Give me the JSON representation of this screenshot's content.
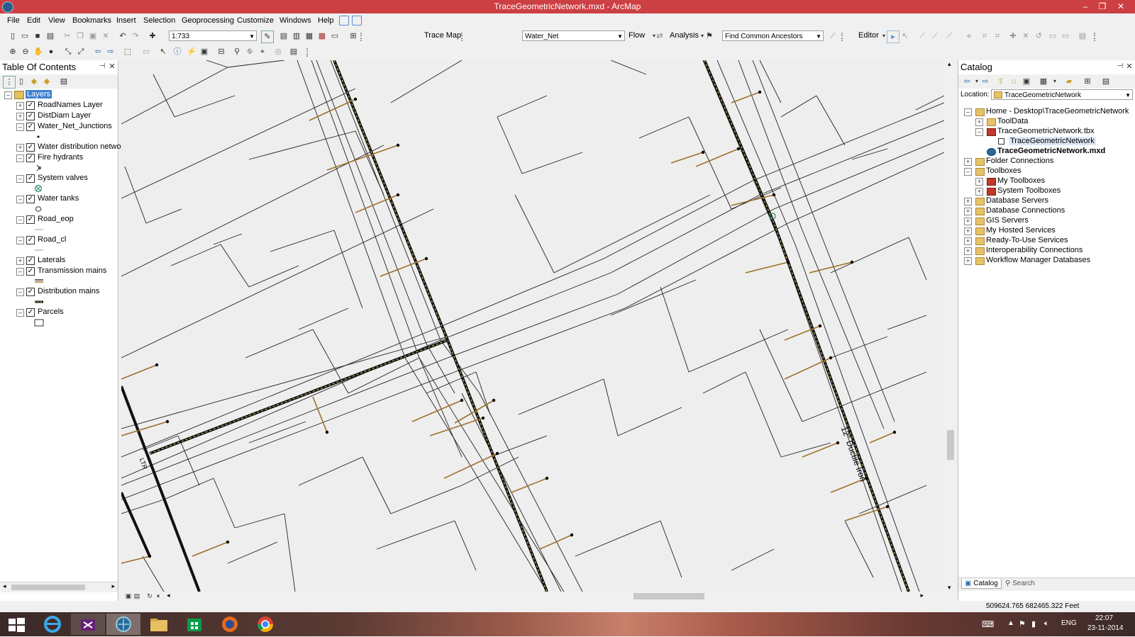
{
  "window": {
    "title": "TraceGeometricNetwork.mxd - ArcMap",
    "buttons": [
      "–",
      "❐",
      "✕"
    ]
  },
  "menu": [
    "File",
    "Edit",
    "View",
    "Bookmarks",
    "Insert",
    "Selection",
    "Geoprocessing",
    "Customize",
    "Windows",
    "Help"
  ],
  "toolbar": {
    "scale": "1:733",
    "trace_map_label": "Trace Map",
    "network": "Water_Net",
    "flow_label": "Flow",
    "analysis_label": "Analysis",
    "trace_task": "Find Common Ancestors",
    "editor_label": "Editor"
  },
  "toc": {
    "title": "Table Of Contents",
    "root": "Layers",
    "layers": [
      {
        "name": "RoadNames Layer",
        "expander": "+",
        "symbol": "none"
      },
      {
        "name": "DistDiam Layer",
        "expander": "+",
        "symbol": "none"
      },
      {
        "name": "Water_Net_Junctions",
        "expander": "–",
        "symbol": "dot"
      },
      {
        "name": "Water distribution netwo",
        "expander": "+",
        "symbol": "none"
      },
      {
        "name": "Fire hydrants",
        "expander": "–",
        "symbol": "hydrant"
      },
      {
        "name": "System valves",
        "expander": "–",
        "symbol": "valve"
      },
      {
        "name": "Water tanks",
        "expander": "–",
        "symbol": "tank"
      },
      {
        "name": "Road_eop",
        "expander": "–",
        "symbol": "line-grey"
      },
      {
        "name": "Road_cl",
        "expander": "–",
        "symbol": "line-grey"
      },
      {
        "name": "Laterals",
        "expander": "+",
        "symbol": "none"
      },
      {
        "name": "Transmission mains",
        "expander": "–",
        "symbol": "double-line"
      },
      {
        "name": "Distribution mains",
        "expander": "–",
        "symbol": "dash-line"
      },
      {
        "name": "Parcels",
        "expander": "–",
        "symbol": "rect"
      }
    ]
  },
  "catalog": {
    "title": "Catalog",
    "location_label": "Location:",
    "location_value": "TraceGeometricNetwork",
    "tree": [
      {
        "label": "Home - Desktop\\TraceGeometricNetwork",
        "level": 0,
        "expander": "–",
        "icon": "home-folder",
        "bold": false,
        "selected": false
      },
      {
        "label": "ToolData",
        "level": 1,
        "expander": "+",
        "icon": "folder",
        "bold": false,
        "selected": false
      },
      {
        "label": "TraceGeometricNetwork.tbx",
        "level": 1,
        "expander": "–",
        "icon": "toolbox",
        "bold": false,
        "selected": false
      },
      {
        "label": "TraceGeometricNetwork",
        "level": 2,
        "expander": "",
        "icon": "model",
        "bold": false,
        "selected": true
      },
      {
        "label": "TraceGeometricNetwork.mxd",
        "level": 1,
        "expander": "",
        "icon": "mxd",
        "bold": true,
        "selected": false
      },
      {
        "label": "Folder Connections",
        "level": 0,
        "expander": "+",
        "icon": "folder",
        "bold": false,
        "selected": false
      },
      {
        "label": "Toolboxes",
        "level": 0,
        "expander": "–",
        "icon": "folder",
        "bold": false,
        "selected": false
      },
      {
        "label": "My Toolboxes",
        "level": 1,
        "expander": "+",
        "icon": "toolbox",
        "bold": false,
        "selected": false
      },
      {
        "label": "System Toolboxes",
        "level": 1,
        "expander": "+",
        "icon": "toolbox",
        "bold": false,
        "selected": false
      },
      {
        "label": "Database Servers",
        "level": 0,
        "expander": "+",
        "icon": "folder",
        "bold": false,
        "selected": false
      },
      {
        "label": "Database Connections",
        "level": 0,
        "expander": "+",
        "icon": "folder",
        "bold": false,
        "selected": false
      },
      {
        "label": "GIS Servers",
        "level": 0,
        "expander": "+",
        "icon": "folder",
        "bold": false,
        "selected": false
      },
      {
        "label": "My Hosted Services",
        "level": 0,
        "expander": "+",
        "icon": "folder",
        "bold": false,
        "selected": false
      },
      {
        "label": "Ready-To-Use Services",
        "level": 0,
        "expander": "+",
        "icon": "folder",
        "bold": false,
        "selected": false
      },
      {
        "label": "Interoperability Connections",
        "level": 0,
        "expander": "+",
        "icon": "folder",
        "bold": false,
        "selected": false
      },
      {
        "label": "Workflow Manager Databases",
        "level": 0,
        "expander": "+",
        "icon": "folder",
        "bold": false,
        "selected": false
      }
    ],
    "tabs": [
      "Catalog",
      "Search"
    ]
  },
  "map": {
    "road_label": "12\" Ductile Iron",
    "small_label": "LTR"
  },
  "status": {
    "coords": "509624.765  682465.322 Feet"
  },
  "taskbar": {
    "lang": "ENG",
    "time": "22:07",
    "date": "23-11-2014"
  },
  "colors": {
    "titlebar": "#cc3f43",
    "lateral": "#a0702a",
    "main": "#111111",
    "parcel": "#222222",
    "road": "#444444"
  }
}
